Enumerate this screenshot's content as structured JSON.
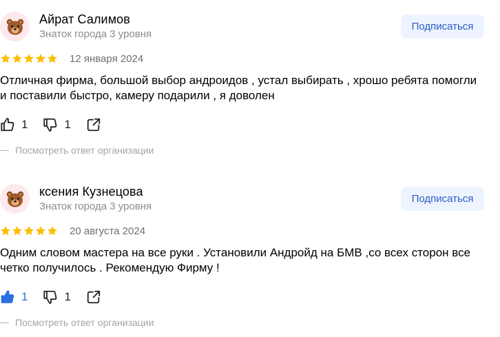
{
  "reviews": [
    {
      "author": "Айрат Салимов",
      "level": "Знаток города 3 уровня",
      "subscribe_label": "Подписаться",
      "rating": 5,
      "date": "12 января 2024",
      "text": "Отличная фирма, большой выбор андроидов , устал выбирать , хрошо ребята помогли и поставили быстро, камеру подарили , я доволен",
      "likes": "1",
      "liked": false,
      "dislikes": "1",
      "answer_link": "Посмотреть ответ организации"
    },
    {
      "author": "ксения Кузнецова",
      "level": "Знаток города 3 уровня",
      "subscribe_label": "Подписаться",
      "rating": 5,
      "date": "20 августа 2024",
      "text": "Одним словом мастера на все руки . Установили Андройд на БМВ ,со всех сторон все четко получилось . Рекомендую Фирму !",
      "likes": "1",
      "liked": true,
      "dislikes": "1",
      "answer_link": "Посмотреть ответ организации"
    }
  ],
  "colors": {
    "star": "#fcbd00",
    "accent": "#2b6fe0",
    "subscribe_bg": "#eef4ff",
    "muted": "#8c8c8c"
  },
  "icons": {
    "avatar": "bear-face-icon",
    "like": "thumbs-up-icon",
    "dislike": "thumbs-down-icon",
    "share": "share-icon"
  }
}
